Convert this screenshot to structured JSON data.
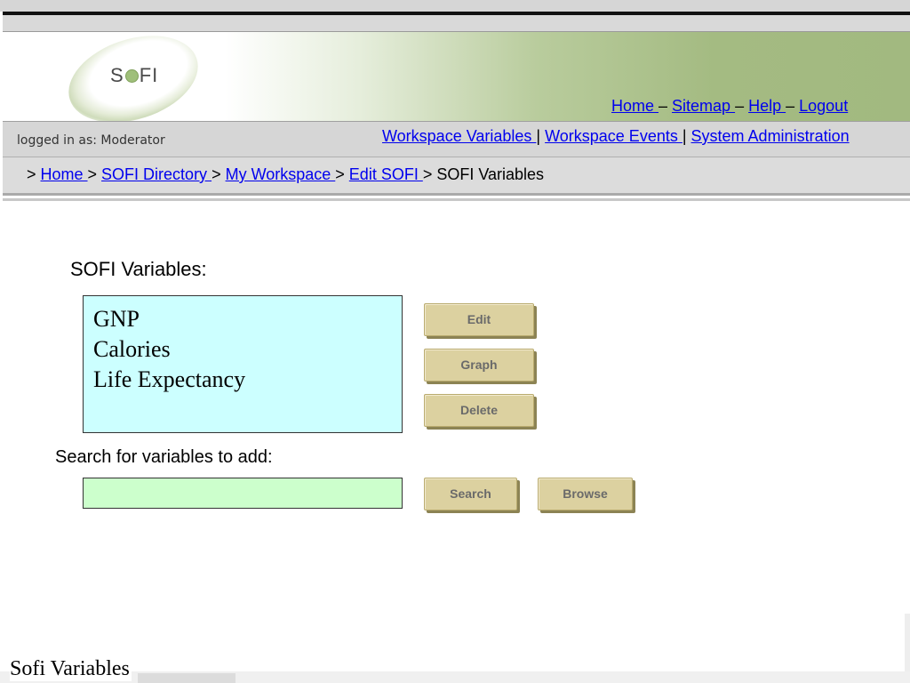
{
  "logo": {
    "text_before": "S",
    "text_after": "FI"
  },
  "top_nav": [
    {
      "label": "Home "
    },
    {
      "label": "Sitemap "
    },
    {
      "label": "Help "
    },
    {
      "label": "Logout"
    }
  ],
  "top_nav_separator": " – ",
  "user_status": "logged in as: Moderator",
  "workspace_nav": [
    {
      "label": "Workspace Variables "
    },
    {
      "label": "Workspace Events "
    },
    {
      "label": "System Administration"
    }
  ],
  "workspace_nav_separator": " | ",
  "breadcrumb": {
    "prefix": "> ",
    "separator": " > ",
    "links": [
      "Home ",
      "SOFI Directory ",
      "My Workspace ",
      "Edit SOFI "
    ],
    "current": "SOFI Variables"
  },
  "main": {
    "heading": "SOFI Variables:",
    "variables": [
      "GNP",
      "Calories",
      "Life Expectancy"
    ],
    "buttons": {
      "edit": "Edit",
      "graph": "Graph",
      "delete": "Delete"
    },
    "search_label": "Search for variables to add:",
    "search_value": "",
    "search_button": "Search",
    "browse_button": "Browse"
  },
  "footer_title": "Sofi Variables",
  "colors": {
    "variable_box": "#ccffff",
    "search_field": "#ccffcc",
    "button_face": "#dcd1a0",
    "link": "#0000ee",
    "banner_green": "#a2b980"
  }
}
